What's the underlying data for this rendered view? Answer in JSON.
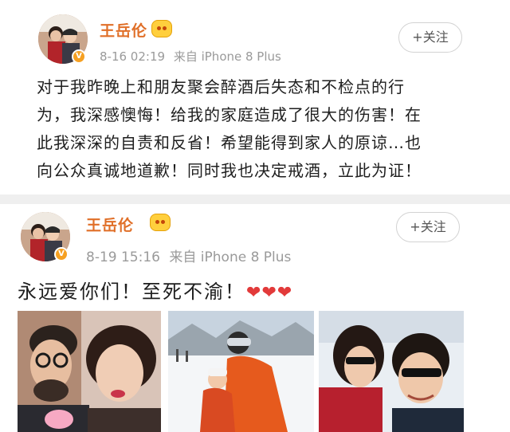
{
  "posts": [
    {
      "username": "王岳伦",
      "time": "8-16 02:19",
      "source": "来自 iPhone 8 Plus",
      "follow_label": "+关注",
      "text_lines": [
        "对于我昨晚上和朋友聚会醉酒后失态和不检点的行",
        "为，我深感懊悔！给我的家庭造成了很大的伤害！在",
        "此我深深的自责和反省！希望能得到家人的原谅…也",
        "向公众真诚地道歉！同时我也决定戒酒，立此为证！"
      ]
    },
    {
      "username": "王岳伦",
      "time": "8-19 15:16",
      "source": "来自 iPhone 8 Plus",
      "follow_label": "+关注",
      "text": "永远爱你们！至死不渝！",
      "emoji": [
        "❤",
        "❤",
        "❤"
      ],
      "photos": [
        "couple-selfie",
        "ski-slope-family",
        "couple-sunglasses-selfie"
      ]
    }
  ],
  "icons": {
    "verified_badge": "verified-v-icon",
    "vip_badge": "vip-crown-icon",
    "heart": "heart-emoji"
  },
  "colors": {
    "username": "#e06f28",
    "meta": "#9a9a9a",
    "text": "#1e1e1e",
    "heart": "#e23a3a",
    "verified": "#f6a022"
  }
}
